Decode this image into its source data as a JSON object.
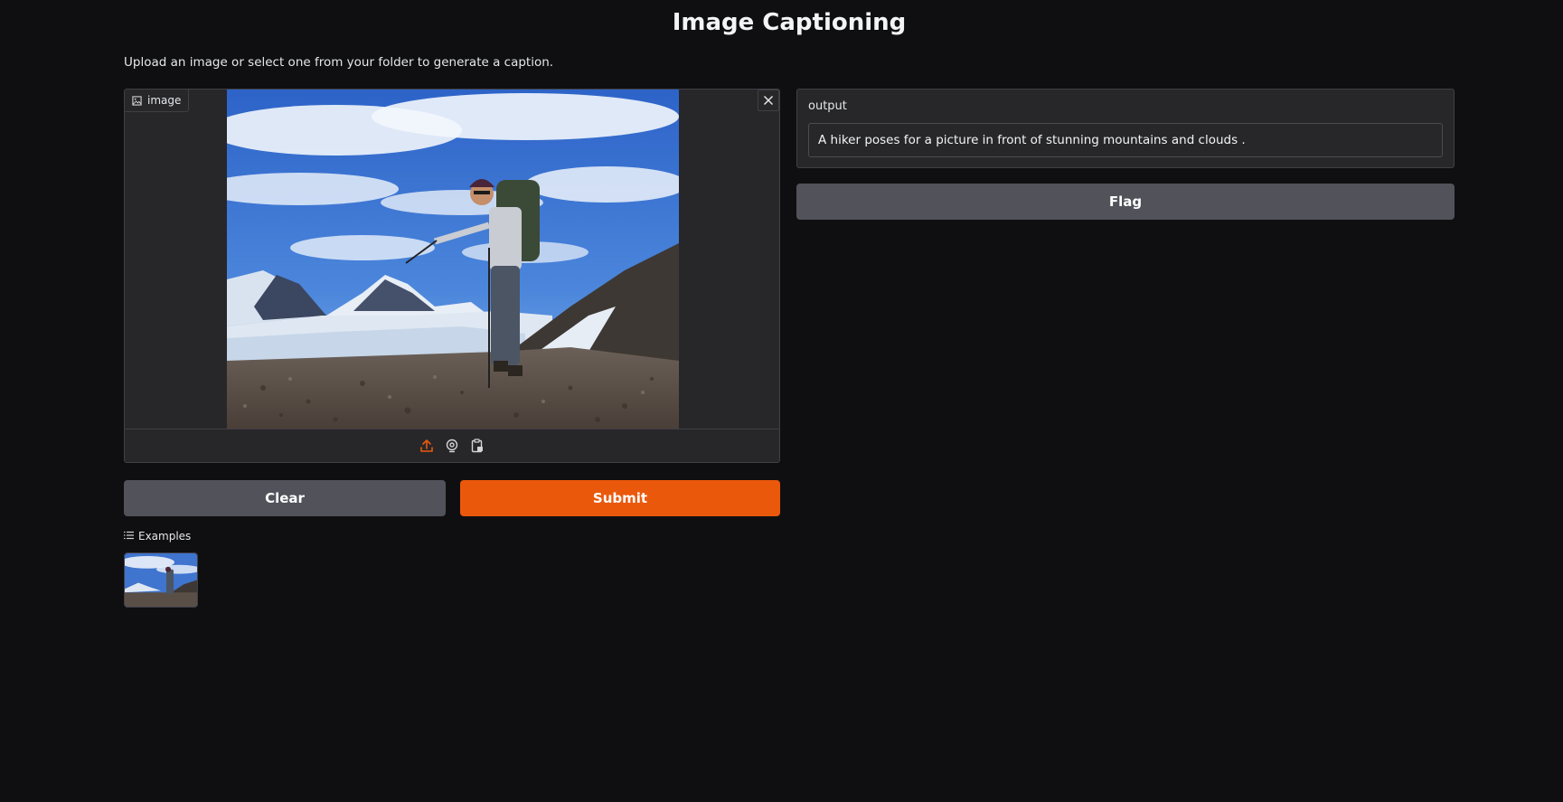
{
  "app": {
    "title": "Image Captioning",
    "description": "Upload an image or select one from your folder to generate a caption."
  },
  "image_input": {
    "label": "image",
    "label_icon": "image-icon",
    "close_icon": "close-icon",
    "toolbar_icons": [
      "upload-icon",
      "webcam-icon",
      "clipboard-icon"
    ],
    "accent_color": "#ea580c"
  },
  "buttons": {
    "clear": "Clear",
    "submit": "Submit",
    "flag": "Flag"
  },
  "examples": {
    "header": "Examples",
    "header_icon": "list-icon"
  },
  "output": {
    "label": "output",
    "value": "A hiker poses for a picture in front of stunning mountains and clouds ."
  },
  "colors": {
    "background": "#0f0f11",
    "panel": "#27272a",
    "primary": "#ea580c",
    "secondary": "#52525b"
  }
}
